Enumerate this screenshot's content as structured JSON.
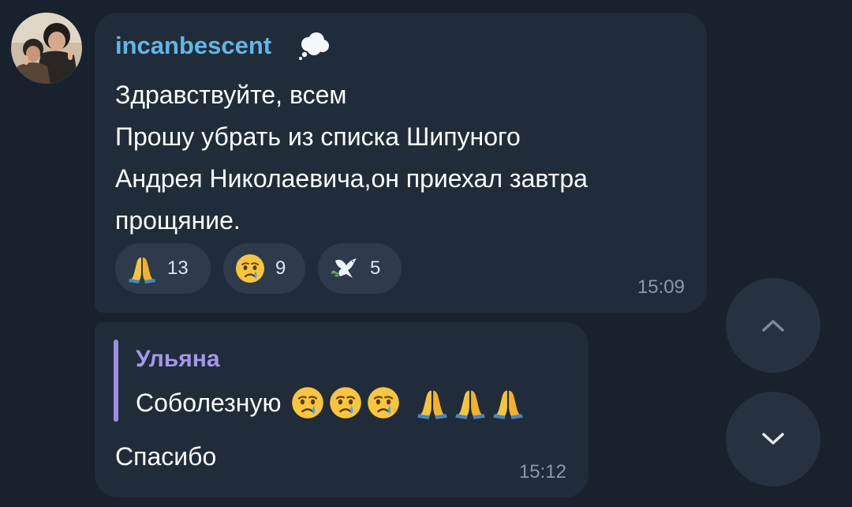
{
  "message1": {
    "sender": "incanbescent",
    "text": "Здравствуйте, всем\nПрошу убрать из списка Шипуного\nАндрея Николаевича,он приехал завтра\nпрощяние.",
    "time": "15:09",
    "status_icon": "thought-bubble-icon",
    "reactions": [
      {
        "emoji": "folded-hands-icon",
        "count": "13"
      },
      {
        "emoji": "crying-face-icon",
        "count": "9"
      },
      {
        "emoji": "dove-icon",
        "count": "5"
      }
    ]
  },
  "message2": {
    "quote": {
      "author": "Ульяна",
      "text": "Соболезную",
      "emojis": [
        "crying-face-icon",
        "crying-face-icon",
        "crying-face-icon",
        "folded-hands-icon",
        "folded-hands-icon",
        "folded-hands-icon"
      ]
    },
    "text": "Спасибо",
    "time": "15:12"
  },
  "nav": {
    "scroll_up_icon": "chevron-up-icon",
    "scroll_down_icon": "chevron-down-icon"
  },
  "colors": {
    "background": "#18212c",
    "bubble": "#212c3a",
    "sender_name": "#62b6e5",
    "quote_author": "#a597e8"
  }
}
